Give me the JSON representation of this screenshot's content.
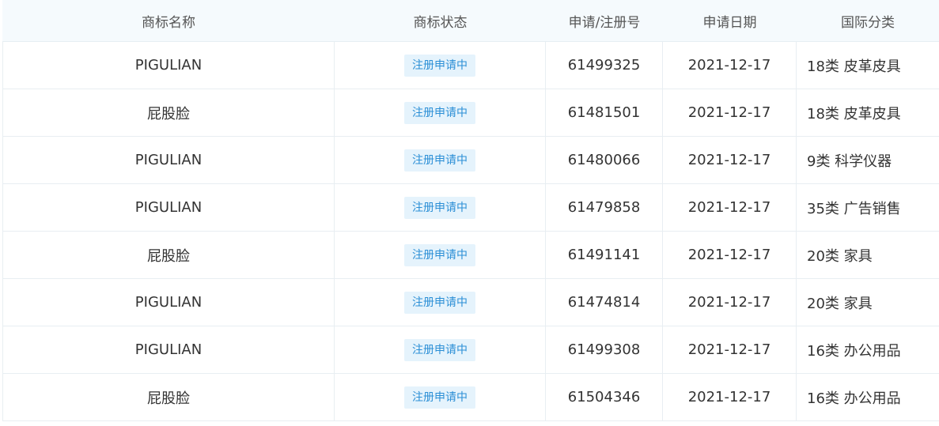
{
  "header": {
    "name": "商标名称",
    "status": "商标状态",
    "reg_no": "申请/注册号",
    "date": "申请日期",
    "class": "国际分类"
  },
  "rows": [
    {
      "name": "PIGULIAN",
      "status": "注册申请中",
      "reg_no": "61499325",
      "date": "2021-12-17",
      "class": "18类 皮革皮具"
    },
    {
      "name": "屁股脸",
      "status": "注册申请中",
      "reg_no": "61481501",
      "date": "2021-12-17",
      "class": "18类 皮革皮具"
    },
    {
      "name": "PIGULIAN",
      "status": "注册申请中",
      "reg_no": "61480066",
      "date": "2021-12-17",
      "class": "9类 科学仪器"
    },
    {
      "name": "PIGULIAN",
      "status": "注册申请中",
      "reg_no": "61479858",
      "date": "2021-12-17",
      "class": "35类 广告销售"
    },
    {
      "name": "屁股脸",
      "status": "注册申请中",
      "reg_no": "61491141",
      "date": "2021-12-17",
      "class": "20类 家具"
    },
    {
      "name": "PIGULIAN",
      "status": "注册申请中",
      "reg_no": "61474814",
      "date": "2021-12-17",
      "class": "20类 家具"
    },
    {
      "name": "PIGULIAN",
      "status": "注册申请中",
      "reg_no": "61499308",
      "date": "2021-12-17",
      "class": "16类 办公用品"
    },
    {
      "name": "屁股脸",
      "status": "注册申请中",
      "reg_no": "61504346",
      "date": "2021-12-17",
      "class": "16类 办公用品"
    }
  ],
  "colors": {
    "header_bg": "#f5fafd",
    "badge_bg": "#e5f3fc",
    "badge_text": "#2b8fd6"
  }
}
